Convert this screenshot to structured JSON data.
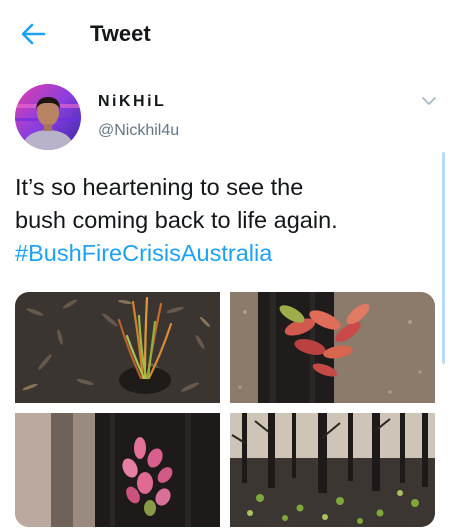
{
  "header": {
    "back_icon": "arrow-left-icon",
    "title": "Tweet"
  },
  "tweet": {
    "display_name": "NiKHiL",
    "handle": "@Nickhil4u",
    "text_line1": "It’s so heartening to see the",
    "text_line2": "bush coming back to life again.",
    "hashtag": "#BushFireCrisisAustralia",
    "more_icon": "chevron-down-icon"
  },
  "colors": {
    "accent": "#1da1f2",
    "text": "#14171a",
    "secondary_text": "#657786"
  }
}
